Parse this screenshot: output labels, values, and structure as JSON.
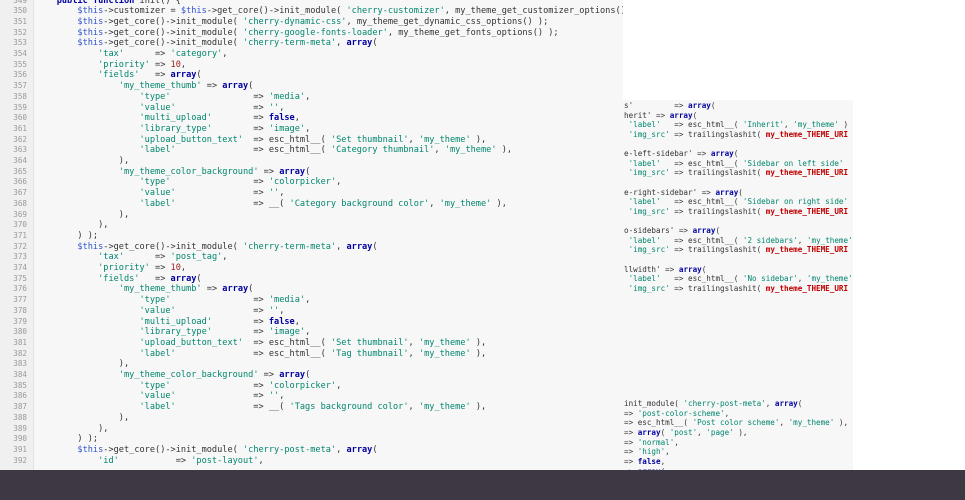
{
  "code_lines": [
    {
      "n": "349",
      "t": "    public function init() {"
    },
    {
      "n": "350",
      "t": "        $this->customizer = $this->get_core()->init_module( 'cherry-customizer', my_theme_get_customizer_options() );"
    },
    {
      "n": "351",
      "t": "        $this->get_core()->init_module( 'cherry-dynamic-css', my_theme_get_dynamic_css_options() );"
    },
    {
      "n": "352",
      "t": "        $this->get_core()->init_module( 'cherry-google-fonts-loader', my_theme_get_fonts_options() );"
    },
    {
      "n": "353",
      "t": "        $this->get_core()->init_module( 'cherry-term-meta', array("
    },
    {
      "n": "354",
      "t": "            'tax'      => 'category',"
    },
    {
      "n": "355",
      "t": "            'priority' => 10,"
    },
    {
      "n": "356",
      "t": "            'fields'   => array("
    },
    {
      "n": "357",
      "t": "                'my_theme_thumb' => array("
    },
    {
      "n": "358",
      "t": "                    'type'                => 'media',"
    },
    {
      "n": "359",
      "t": "                    'value'               => '',"
    },
    {
      "n": "360",
      "t": "                    'multi_upload'        => false,"
    },
    {
      "n": "361",
      "t": "                    'library_type'        => 'image',"
    },
    {
      "n": "362",
      "t": "                    'upload_button_text'  => esc_html__( 'Set thumbnail', 'my_theme' ),"
    },
    {
      "n": "363",
      "t": "                    'label'               => esc_html__( 'Category thumbnail', 'my_theme' ),"
    },
    {
      "n": "364",
      "t": "                ),"
    },
    {
      "n": "365",
      "t": "                'my_theme_color_background' => array("
    },
    {
      "n": "366",
      "t": "                    'type'                => 'colorpicker',"
    },
    {
      "n": "367",
      "t": "                    'value'               => '',"
    },
    {
      "n": "368",
      "t": "                    'label'               => __( 'Category background color', 'my_theme' ),"
    },
    {
      "n": "369",
      "t": "                ),"
    },
    {
      "n": "370",
      "t": "            ),"
    },
    {
      "n": "371",
      "t": "        ) );"
    },
    {
      "n": "372",
      "t": "        $this->get_core()->init_module( 'cherry-term-meta', array("
    },
    {
      "n": "373",
      "t": "            'tax'      => 'post_tag',"
    },
    {
      "n": "374",
      "t": "            'priority' => 10,"
    },
    {
      "n": "375",
      "t": "            'fields'   => array("
    },
    {
      "n": "376",
      "t": "                'my_theme_thumb' => array("
    },
    {
      "n": "377",
      "t": "                    'type'                => 'media',"
    },
    {
      "n": "378",
      "t": "                    'value'               => '',"
    },
    {
      "n": "379",
      "t": "                    'multi_upload'        => false,"
    },
    {
      "n": "380",
      "t": "                    'library_type'        => 'image',"
    },
    {
      "n": "381",
      "t": "                    'upload_button_text'  => esc_html__( 'Set thumbnail', 'my_theme' ),"
    },
    {
      "n": "382",
      "t": "                    'label'               => esc_html__( 'Tag thumbnail', 'my_theme' ),"
    },
    {
      "n": "383",
      "t": "                ),"
    },
    {
      "n": "384",
      "t": "                'my_theme_color_background' => array("
    },
    {
      "n": "385",
      "t": "                    'type'                => 'colorpicker',"
    },
    {
      "n": "386",
      "t": "                    'value'               => '',"
    },
    {
      "n": "387",
      "t": "                    'label'               => __( 'Tags background color', 'my_theme' ),"
    },
    {
      "n": "388",
      "t": "                ),"
    },
    {
      "n": "389",
      "t": "            ),"
    },
    {
      "n": "390",
      "t": "        ) );"
    },
    {
      "n": "391",
      "t": "        $this->get_core()->init_module( 'cherry-post-meta', array("
    },
    {
      "n": "392",
      "t": "            'id'           => 'post-layout',"
    }
  ],
  "right_lines": [
    "s'         => array(",
    "herit' => array(",
    " 'label'   => esc_html__( 'Inherit', 'my_theme' )",
    " 'img_src' => trailingslashit( my_theme_THEME_URI )",
    "",
    "e-left-sidebar' => array(",
    " 'label'   => esc_html__( 'Sidebar on left side'",
    " 'img_src' => trailingslashit( my_theme_THEME_URI )",
    "",
    "e-right-sidebar' => array(",
    " 'label'   => esc_html__( 'Sidebar on right side'",
    " 'img_src' => trailingslashit( my_theme_THEME_URI )",
    "",
    "o-sidebars' => array(",
    " 'label'   => esc_html__( '2 sidebars', 'my_theme' )",
    " 'img_src' => trailingslashit( my_theme_THEME_URI )",
    "",
    "llwidth' => array(",
    " 'label'   => esc_html__( 'No sidebar', 'my_theme' )",
    " 'img_src' => trailingslashit( my_theme_THEME_URI )",
    "",
    "",
    "",
    "",
    "",
    "",
    "",
    "",
    "",
    "",
    "",
    "init_module( 'cherry-post-meta', array(",
    "=> 'post-color-scheme',",
    "=> esc_html__( 'Post color scheme', 'my_theme' ),",
    "=> array( 'post', 'page' ),",
    "=> 'normal',",
    "=> 'high',",
    "=> false,",
    "=> array("
  ],
  "colors": {
    "keyword": "#0000a0",
    "string": "#00866e",
    "variable": "#3355cc",
    "number": "#a02020",
    "constant": "#c00000"
  }
}
